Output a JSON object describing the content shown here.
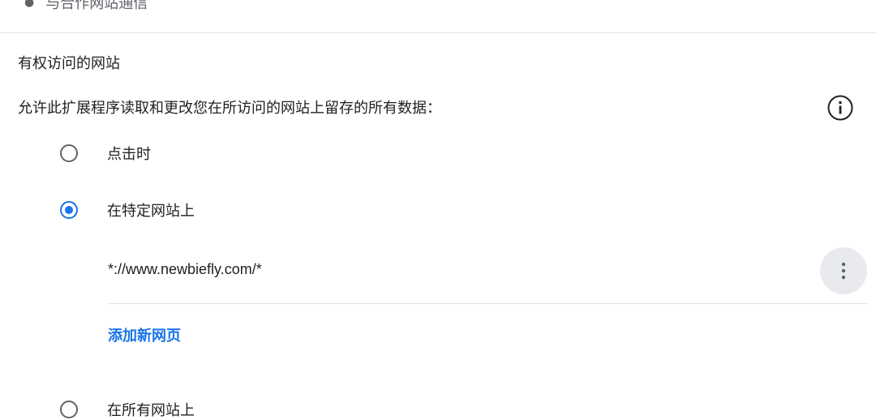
{
  "top_list": {
    "item": "与合作网站通信"
  },
  "site_access": {
    "section_title": "有权访问的网站",
    "description": "允许此扩展程序读取和更改您在所访问的网站上留存的所有数据：",
    "options": [
      {
        "label": "点击时",
        "checked": false
      },
      {
        "label": "在特定网站上",
        "checked": true
      },
      {
        "label": "在所有网站上",
        "checked": false
      }
    ],
    "sites": [
      {
        "pattern": "*://www.newbiefly.com/*"
      }
    ],
    "add_link": "添加新网页"
  },
  "icons": {
    "info": "info-icon",
    "more": "more-vert-icon"
  },
  "colors": {
    "accent": "#1a73e8",
    "text": "#202124",
    "secondary": "#5f6368",
    "divider": "#e0e0e0",
    "button_bg": "#e8eaed"
  }
}
